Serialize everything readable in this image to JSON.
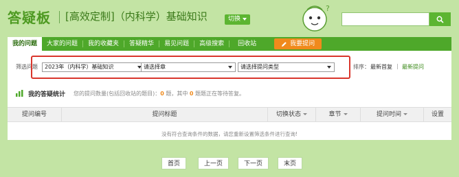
{
  "header": {
    "logo": "答疑板",
    "course_title": "[高效定制]（内科学）基础知识",
    "switch_label": "切换",
    "search": {
      "value": "",
      "placeholder": ""
    }
  },
  "nav": {
    "items": [
      {
        "label": "我的问题",
        "active": true
      },
      {
        "label": "大家的问题",
        "active": false
      },
      {
        "label": "我的收藏夹",
        "active": false
      },
      {
        "label": "答疑精华",
        "active": false
      },
      {
        "label": "易见问题",
        "active": false
      },
      {
        "label": "高级搜索",
        "active": false
      },
      {
        "label": "回收站",
        "active": false
      }
    ],
    "ask_label": "我要提问"
  },
  "filter": {
    "label": "筛选问题",
    "course_select": "2023年（内科学）基础知识",
    "chapter_select": "请选择章",
    "type_select": "请选择提问类型",
    "sort_label": "排序：",
    "sort_options": [
      "最新首复",
      "最新提问"
    ],
    "sort_separator": "|"
  },
  "stats": {
    "title": "我的答疑统计",
    "text_prefix": "您的提问数量(包括回收站的题目)：",
    "total": "0",
    "text_mid": " 题，其中 ",
    "pending": "0",
    "text_suffix": " 题题正在等待答复。"
  },
  "table": {
    "columns": [
      "提问编号",
      "提问标题",
      "切换状态",
      "章节",
      "提问时间",
      "设置"
    ],
    "empty_message": "没有符合查询条件的数据，请您重新设置筛选条件进行查询!"
  },
  "pager": {
    "first": "首页",
    "prev": "上一页",
    "next": "下一页",
    "last": "末页"
  },
  "colors": {
    "brand_green": "#4ea82a",
    "page_bg": "#c3e4a4",
    "accent_orange": "#f08a1c",
    "highlight_red": "#d9352b"
  }
}
